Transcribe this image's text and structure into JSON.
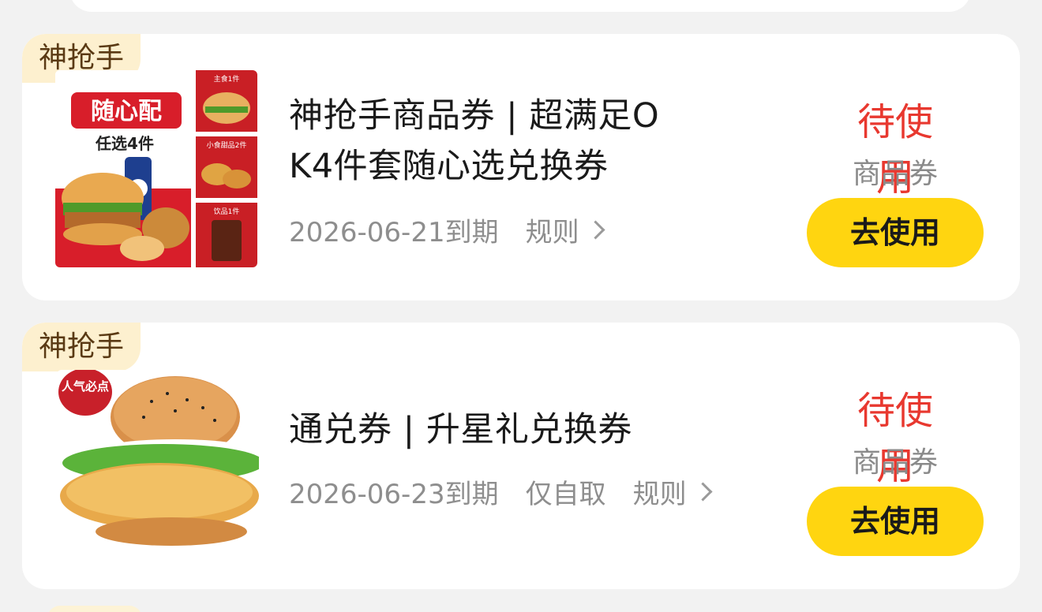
{
  "coupons": [
    {
      "tag": "神抢手",
      "title_line1": "神抢手商品券 | 超满足O",
      "title_line2": "K4件套随心选兑换券",
      "expiry": "2026-06-21到期",
      "extra": "",
      "rules_label": "规则",
      "status": "待使用",
      "type": "商品券",
      "button_label": "去使用",
      "image": {
        "banner": "随心配",
        "subtitle": "任选4件",
        "side_labels": [
          "主食1件",
          "小食甜品2件",
          "饮品1件"
        ]
      }
    },
    {
      "tag": "神抢手",
      "title_line1": "通兑券 | 升星礼兑换券",
      "title_line2": "",
      "expiry": "2026-06-23到期",
      "extra": "仅自取",
      "rules_label": "规则",
      "status": "待使用",
      "type": "商品券",
      "button_label": "去使用",
      "image": {
        "badge": "人气必点"
      }
    }
  ],
  "colors": {
    "accent_yellow": "#ffd510",
    "status_red": "#e8382f",
    "tag_bg": "#fdf0cf",
    "tag_text": "#5a3a14"
  }
}
